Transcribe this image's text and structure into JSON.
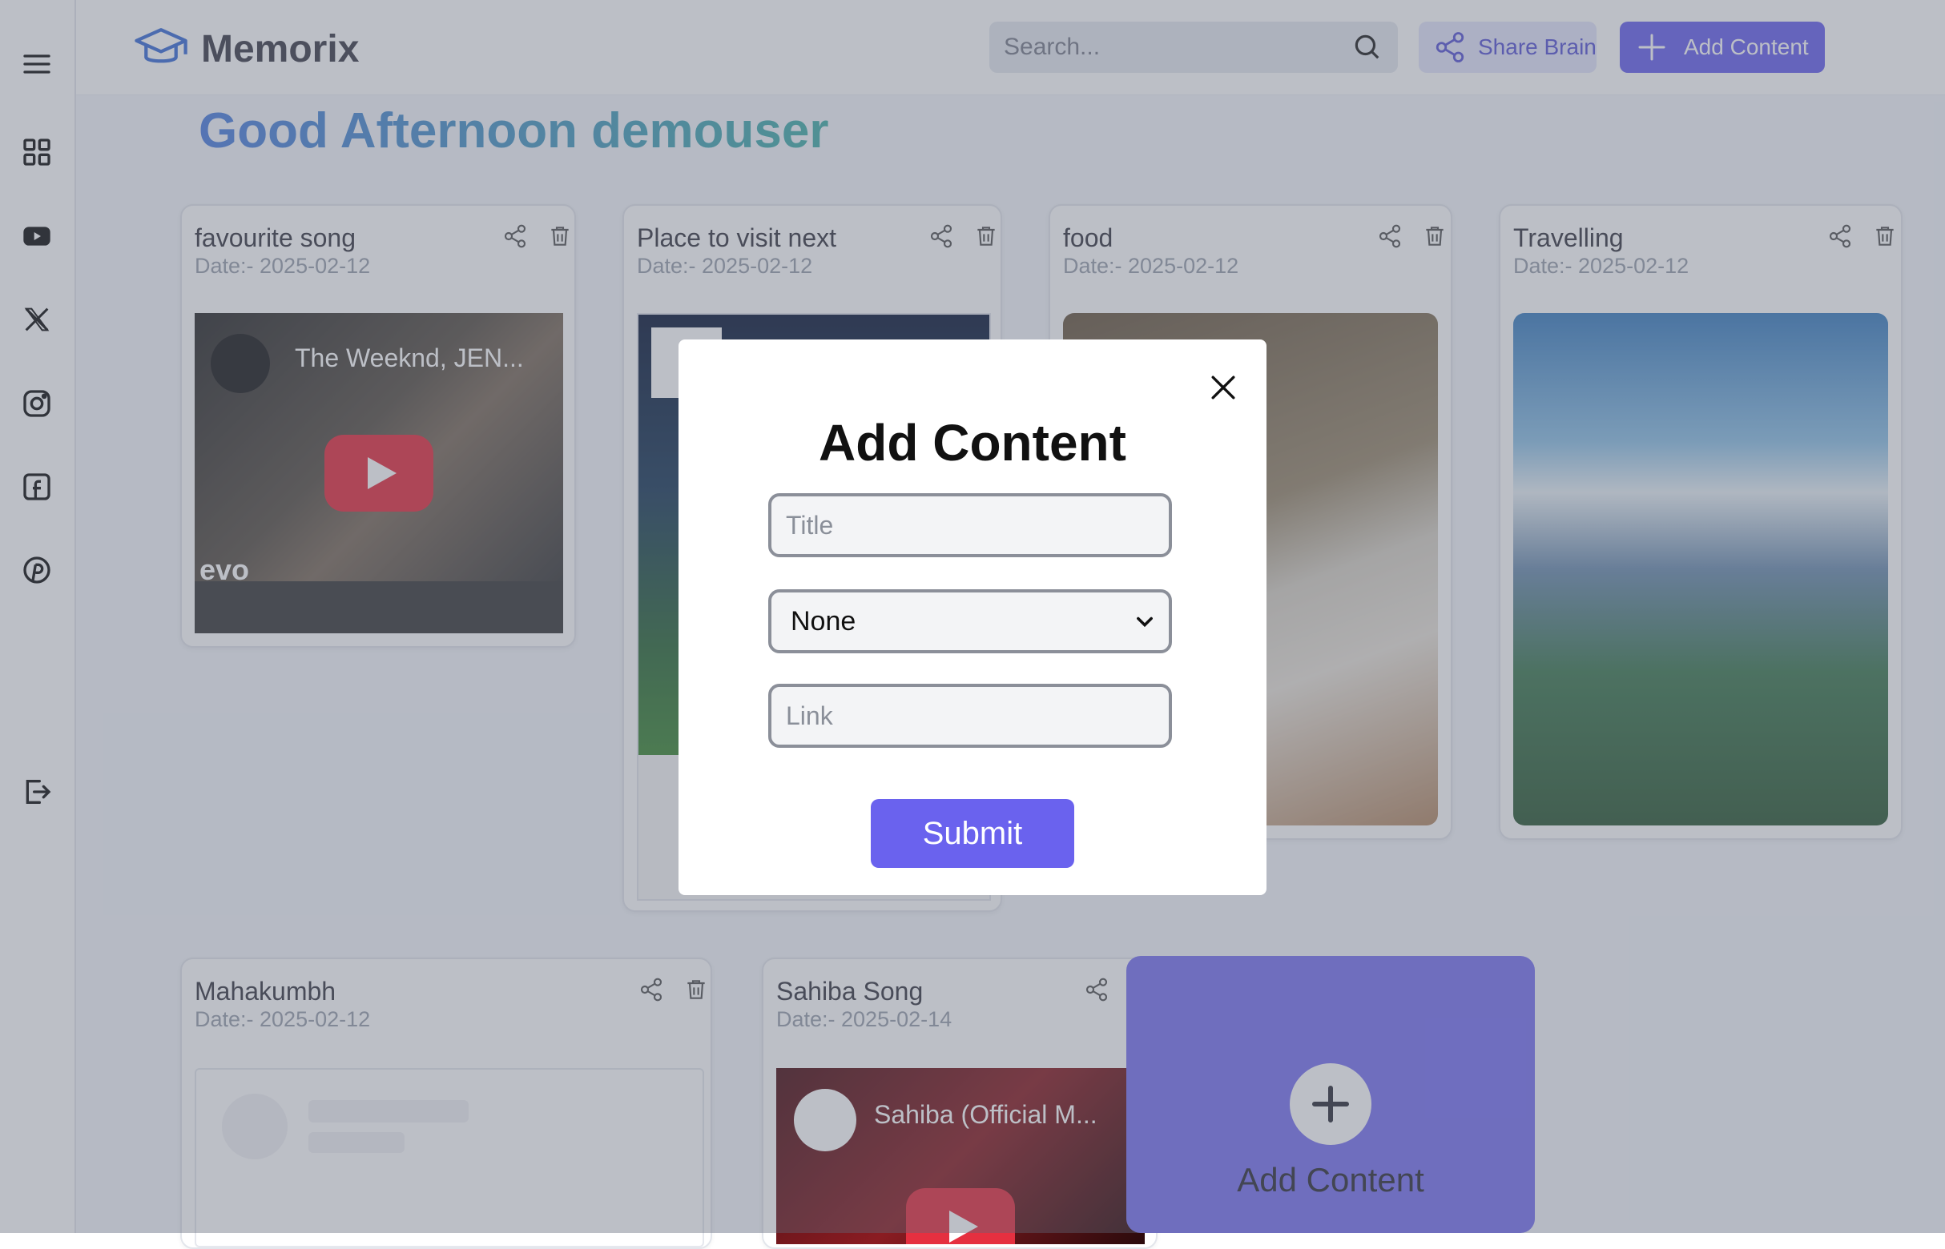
{
  "app": {
    "name": "Memorix"
  },
  "header": {
    "search_placeholder": "Search...",
    "share_label": "Share Brain",
    "add_label": "Add Content"
  },
  "greeting": "Good Afternoon demouser",
  "sidebar": {
    "items": [
      "menu-icon",
      "grid-icon",
      "youtube-icon",
      "x-icon",
      "instagram-icon",
      "facebook-icon",
      "pinterest-icon",
      "logout-icon"
    ]
  },
  "cards": [
    {
      "title": "favourite song",
      "date": "Date:- 2025-02-12",
      "video_title": "The Weeknd, JEN...",
      "badge": "evo"
    },
    {
      "title": "Place to visit next",
      "date": "Date:- 2025-02-12"
    },
    {
      "title": "food",
      "date": "Date:- 2025-02-12"
    },
    {
      "title": "Travelling",
      "date": "Date:- 2025-02-12"
    },
    {
      "title": "Mahakumbh",
      "date": "Date:- 2025-02-12"
    },
    {
      "title": "Sahiba Song",
      "date": "Date:- 2025-02-14",
      "video_title": "Sahiba (Official M..."
    }
  ],
  "add_card": {
    "label": "Add Content"
  },
  "modal": {
    "title": "Add Content",
    "title_placeholder": "Title",
    "type_selected": "None",
    "link_placeholder": "Link",
    "submit_label": "Submit"
  },
  "colors": {
    "accent": "#6a62ee",
    "overlay": "#5f6678"
  }
}
